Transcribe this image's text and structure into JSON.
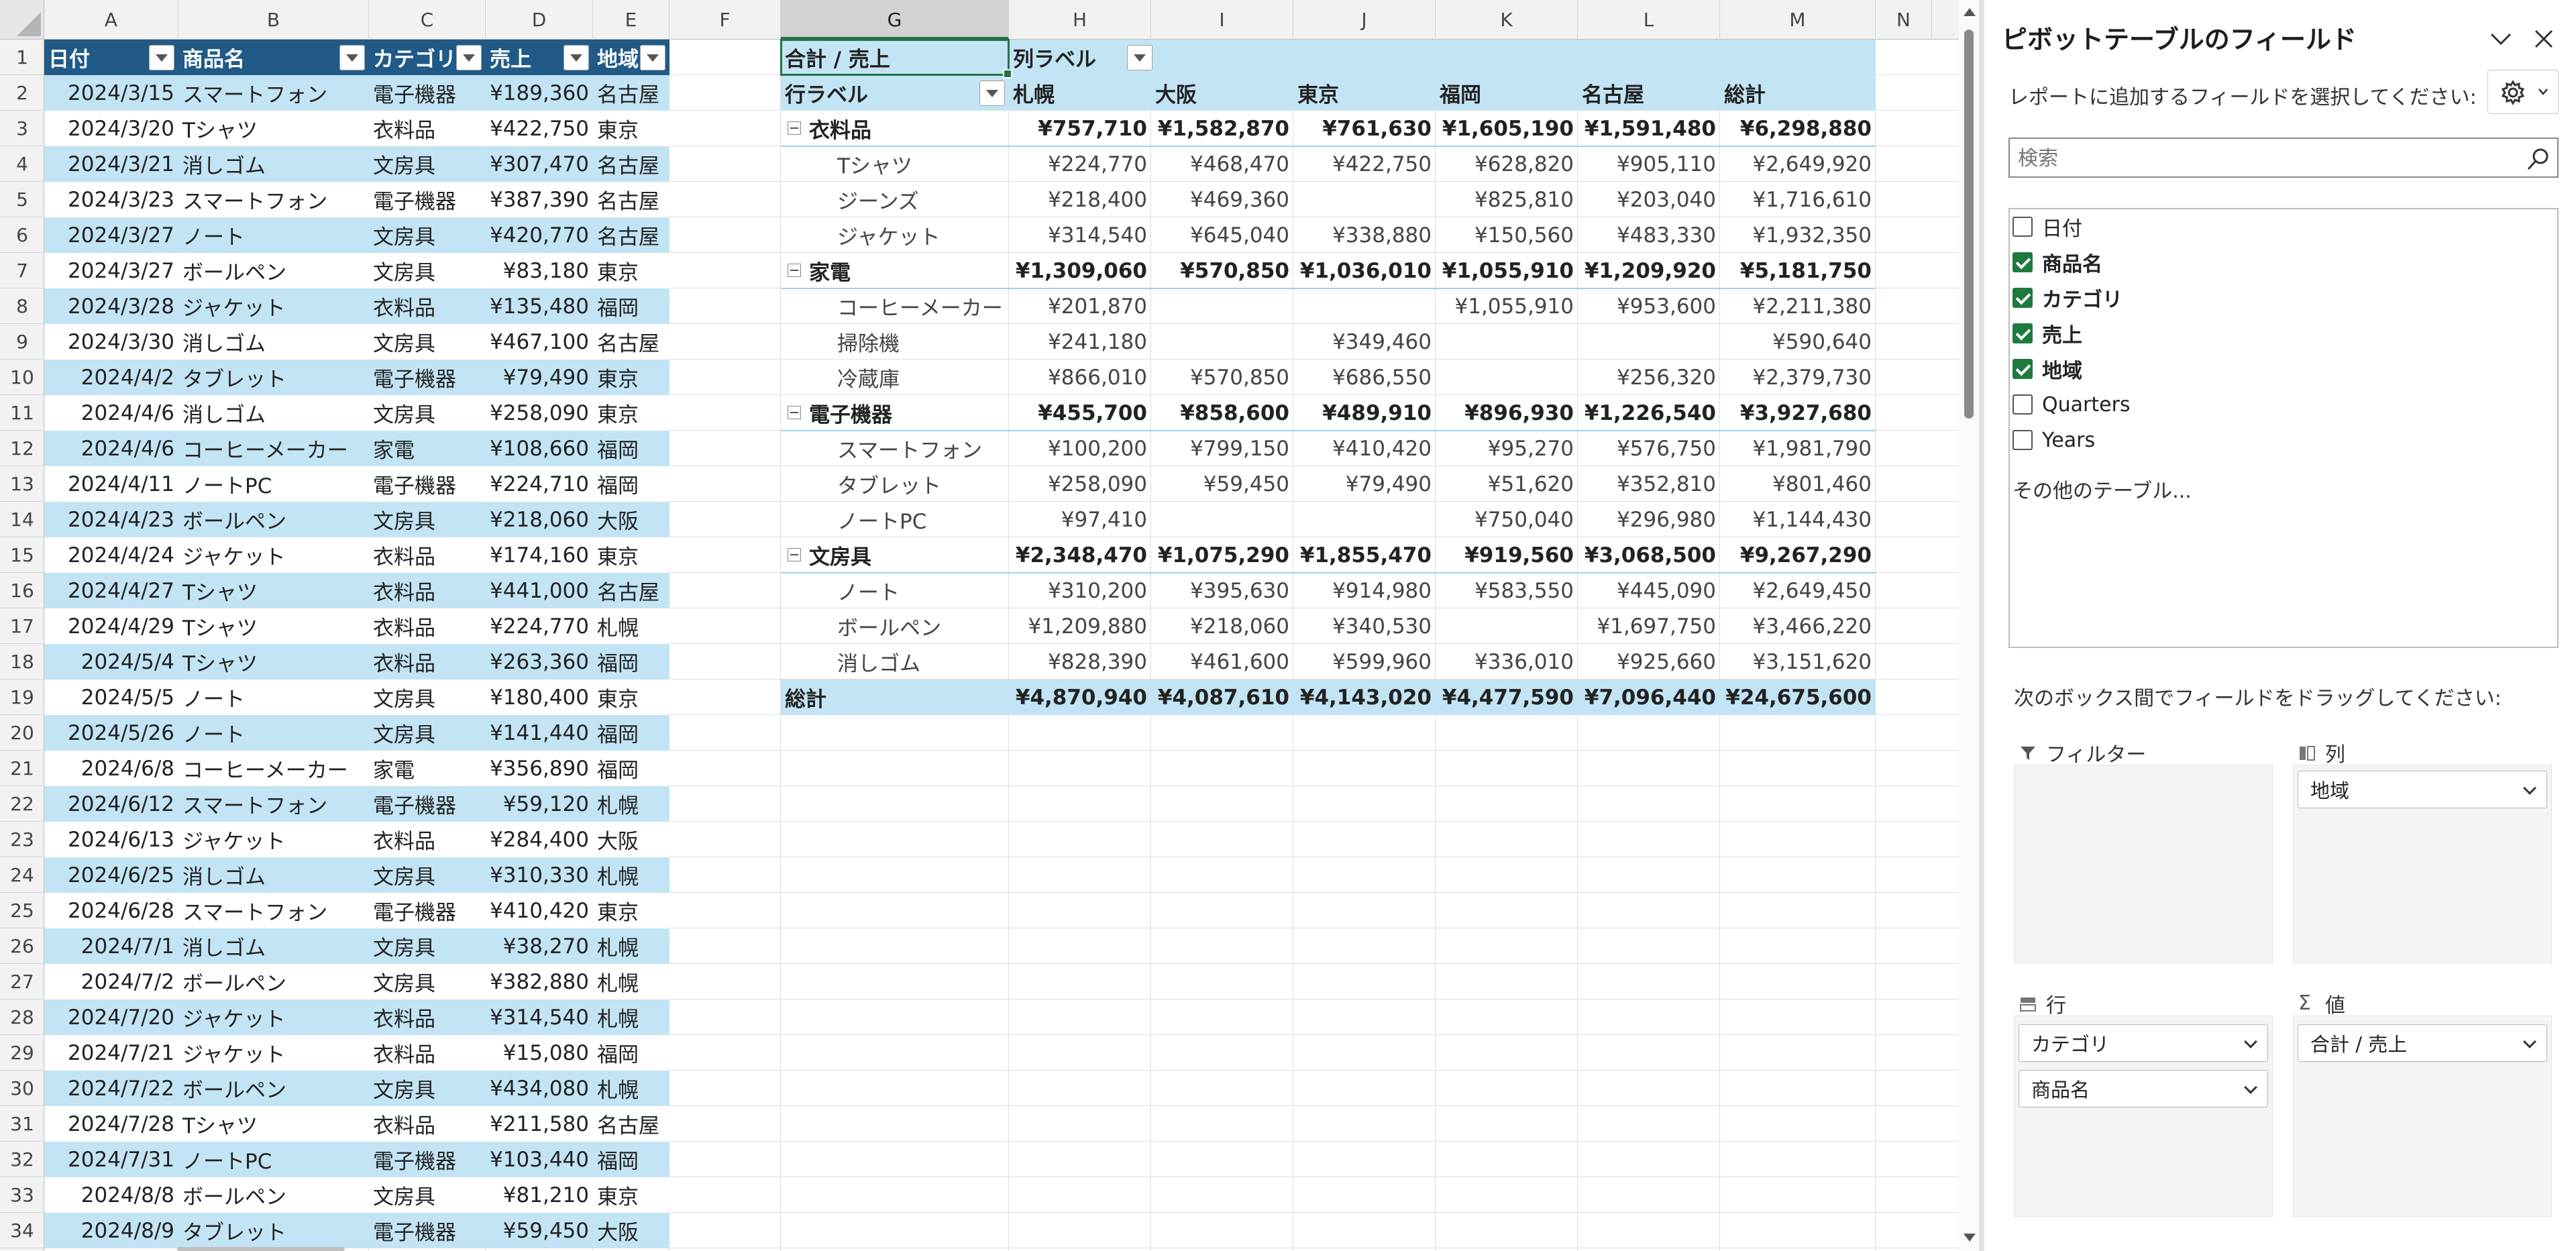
{
  "columns": [
    {
      "letter": "A"
    },
    {
      "letter": "B"
    },
    {
      "letter": "C"
    },
    {
      "letter": "D"
    },
    {
      "letter": "E"
    },
    {
      "letter": "F"
    },
    {
      "letter": "G",
      "selected": true
    },
    {
      "letter": "H"
    },
    {
      "letter": "I"
    },
    {
      "letter": "J"
    },
    {
      "letter": "K"
    },
    {
      "letter": "L"
    },
    {
      "letter": "M"
    },
    {
      "letter": "N"
    }
  ],
  "rows_start": 1,
  "rows_count": 34,
  "table": {
    "headers": [
      "日付",
      "商品名",
      "カテゴリ",
      "売上",
      "地域"
    ],
    "rows": [
      [
        "2024/3/15",
        "スマートフォン",
        "電子機器",
        "¥189,360",
        "名古屋"
      ],
      [
        "2024/3/20",
        "Tシャツ",
        "衣料品",
        "¥422,750",
        "東京"
      ],
      [
        "2024/3/21",
        "消しゴム",
        "文房具",
        "¥307,470",
        "名古屋"
      ],
      [
        "2024/3/23",
        "スマートフォン",
        "電子機器",
        "¥387,390",
        "名古屋"
      ],
      [
        "2024/3/27",
        "ノート",
        "文房具",
        "¥420,770",
        "名古屋"
      ],
      [
        "2024/3/27",
        "ボールペン",
        "文房具",
        "¥83,180",
        "東京"
      ],
      [
        "2024/3/28",
        "ジャケット",
        "衣料品",
        "¥135,480",
        "福岡"
      ],
      [
        "2024/3/30",
        "消しゴム",
        "文房具",
        "¥467,100",
        "名古屋"
      ],
      [
        "2024/4/2",
        "タブレット",
        "電子機器",
        "¥79,490",
        "東京"
      ],
      [
        "2024/4/6",
        "消しゴム",
        "文房具",
        "¥258,090",
        "東京"
      ],
      [
        "2024/4/6",
        "コーヒーメーカー",
        "家電",
        "¥108,660",
        "福岡"
      ],
      [
        "2024/4/11",
        "ノートPC",
        "電子機器",
        "¥224,710",
        "福岡"
      ],
      [
        "2024/4/23",
        "ボールペン",
        "文房具",
        "¥218,060",
        "大阪"
      ],
      [
        "2024/4/24",
        "ジャケット",
        "衣料品",
        "¥174,160",
        "東京"
      ],
      [
        "2024/4/27",
        "Tシャツ",
        "衣料品",
        "¥441,000",
        "名古屋"
      ],
      [
        "2024/4/29",
        "Tシャツ",
        "衣料品",
        "¥224,770",
        "札幌"
      ],
      [
        "2024/5/4",
        "Tシャツ",
        "衣料品",
        "¥263,360",
        "福岡"
      ],
      [
        "2024/5/5",
        "ノート",
        "文房具",
        "¥180,400",
        "東京"
      ],
      [
        "2024/5/26",
        "ノート",
        "文房具",
        "¥141,440",
        "福岡"
      ],
      [
        "2024/6/8",
        "コーヒーメーカー",
        "家電",
        "¥356,890",
        "福岡"
      ],
      [
        "2024/6/12",
        "スマートフォン",
        "電子機器",
        "¥59,120",
        "札幌"
      ],
      [
        "2024/6/13",
        "ジャケット",
        "衣料品",
        "¥284,400",
        "大阪"
      ],
      [
        "2024/6/25",
        "消しゴム",
        "文房具",
        "¥310,330",
        "札幌"
      ],
      [
        "2024/6/28",
        "スマートフォン",
        "電子機器",
        "¥410,420",
        "東京"
      ],
      [
        "2024/7/1",
        "消しゴム",
        "文房具",
        "¥38,270",
        "札幌"
      ],
      [
        "2024/7/2",
        "ボールペン",
        "文房具",
        "¥382,880",
        "札幌"
      ],
      [
        "2024/7/20",
        "ジャケット",
        "衣料品",
        "¥314,540",
        "札幌"
      ],
      [
        "2024/7/21",
        "ジャケット",
        "衣料品",
        "¥15,080",
        "福岡"
      ],
      [
        "2024/7/22",
        "ボールペン",
        "文房具",
        "¥434,080",
        "札幌"
      ],
      [
        "2024/7/28",
        "Tシャツ",
        "衣料品",
        "¥211,580",
        "名古屋"
      ],
      [
        "2024/7/31",
        "ノートPC",
        "電子機器",
        "¥103,440",
        "福岡"
      ],
      [
        "2024/8/8",
        "ボールペン",
        "文房具",
        "¥81,210",
        "東京"
      ],
      [
        "2024/8/9",
        "タブレット",
        "電子機器",
        "¥59,450",
        "大阪"
      ]
    ]
  },
  "pivot": {
    "value_label": "合計 / 売上",
    "col_label": "列ラベル",
    "row_label": "行ラベル",
    "regions": [
      "札幌",
      "大阪",
      "東京",
      "福岡",
      "名古屋",
      "総計"
    ],
    "groups": [
      {
        "name": "衣料品",
        "values": [
          "¥757,710",
          "¥1,582,870",
          "¥761,630",
          "¥1,605,190",
          "¥1,591,480",
          "¥6,298,880"
        ],
        "items": [
          {
            "name": "Tシャツ",
            "values": [
              "¥224,770",
              "¥468,470",
              "¥422,750",
              "¥628,820",
              "¥905,110",
              "¥2,649,920"
            ]
          },
          {
            "name": "ジーンズ",
            "values": [
              "¥218,400",
              "¥469,360",
              "",
              "¥825,810",
              "¥203,040",
              "¥1,716,610"
            ]
          },
          {
            "name": "ジャケット",
            "values": [
              "¥314,540",
              "¥645,040",
              "¥338,880",
              "¥150,560",
              "¥483,330",
              "¥1,932,350"
            ]
          }
        ]
      },
      {
        "name": "家電",
        "values": [
          "¥1,309,060",
          "¥570,850",
          "¥1,036,010",
          "¥1,055,910",
          "¥1,209,920",
          "¥5,181,750"
        ],
        "items": [
          {
            "name": "コーヒーメーカー",
            "values": [
              "¥201,870",
              "",
              "",
              "¥1,055,910",
              "¥953,600",
              "¥2,211,380"
            ]
          },
          {
            "name": "掃除機",
            "values": [
              "¥241,180",
              "",
              "¥349,460",
              "",
              "",
              "¥590,640"
            ]
          },
          {
            "name": "冷蔵庫",
            "values": [
              "¥866,010",
              "¥570,850",
              "¥686,550",
              "",
              "¥256,320",
              "¥2,379,730"
            ]
          }
        ]
      },
      {
        "name": "電子機器",
        "values": [
          "¥455,700",
          "¥858,600",
          "¥489,910",
          "¥896,930",
          "¥1,226,540",
          "¥3,927,680"
        ],
        "items": [
          {
            "name": "スマートフォン",
            "values": [
              "¥100,200",
              "¥799,150",
              "¥410,420",
              "¥95,270",
              "¥576,750",
              "¥1,981,790"
            ]
          },
          {
            "name": "タブレット",
            "values": [
              "¥258,090",
              "¥59,450",
              "¥79,490",
              "¥51,620",
              "¥352,810",
              "¥801,460"
            ]
          },
          {
            "name": "ノートPC",
            "values": [
              "¥97,410",
              "",
              "",
              "¥750,040",
              "¥296,980",
              "¥1,144,430"
            ]
          }
        ]
      },
      {
        "name": "文房具",
        "values": [
          "¥2,348,470",
          "¥1,075,290",
          "¥1,855,470",
          "¥919,560",
          "¥3,068,500",
          "¥9,267,290"
        ],
        "items": [
          {
            "name": "ノート",
            "values": [
              "¥310,200",
              "¥395,630",
              "¥914,980",
              "¥583,550",
              "¥445,090",
              "¥2,649,450"
            ]
          },
          {
            "name": "ボールペン",
            "values": [
              "¥1,209,880",
              "¥218,060",
              "¥340,530",
              "",
              "¥1,697,750",
              "¥3,466,220"
            ]
          },
          {
            "name": "消しゴム",
            "values": [
              "¥828,390",
              "¥461,600",
              "¥599,960",
              "¥336,010",
              "¥925,660",
              "¥3,151,620"
            ]
          }
        ]
      }
    ],
    "total_label": "総計",
    "total_values": [
      "¥4,870,940",
      "¥4,087,610",
      "¥4,143,020",
      "¥4,477,590",
      "¥7,096,440",
      "¥24,675,600"
    ]
  },
  "panel": {
    "title": "ピボットテーブルのフィールド",
    "instruction": "レポートに追加するフィールドを選択してください:",
    "search_placeholder": "検索",
    "fields": [
      {
        "label": "日付",
        "checked": false
      },
      {
        "label": "商品名",
        "checked": true
      },
      {
        "label": "カテゴリ",
        "checked": true
      },
      {
        "label": "売上",
        "checked": true
      },
      {
        "label": "地域",
        "checked": true
      },
      {
        "label": "Quarters",
        "checked": false
      },
      {
        "label": "Years",
        "checked": false
      }
    ],
    "more_tables": "その他のテーブル...",
    "drag_instruction": "次のボックス間でフィールドをドラッグしてください:",
    "areas": {
      "filter": {
        "label": "フィルター",
        "items": []
      },
      "columns": {
        "label": "列",
        "items": [
          "地域"
        ]
      },
      "rows": {
        "label": "行",
        "items": [
          "カテゴリ",
          "商品名"
        ]
      },
      "values": {
        "label": "値",
        "items": [
          "合計 / 売上"
        ]
      }
    }
  },
  "colors": {
    "header_bg": "#215a86",
    "band_bg": "#c3e4f4",
    "pivot_bg": "#c3e4f4",
    "accent": "#217346",
    "check": "#1f7a3f"
  },
  "icons": {
    "filter_button": "dropdown-arrow-icon",
    "collapse": "minus-icon",
    "gear": "gear-icon",
    "search": "search-icon",
    "close": "close-icon",
    "chevron": "chevron-down-icon"
  }
}
